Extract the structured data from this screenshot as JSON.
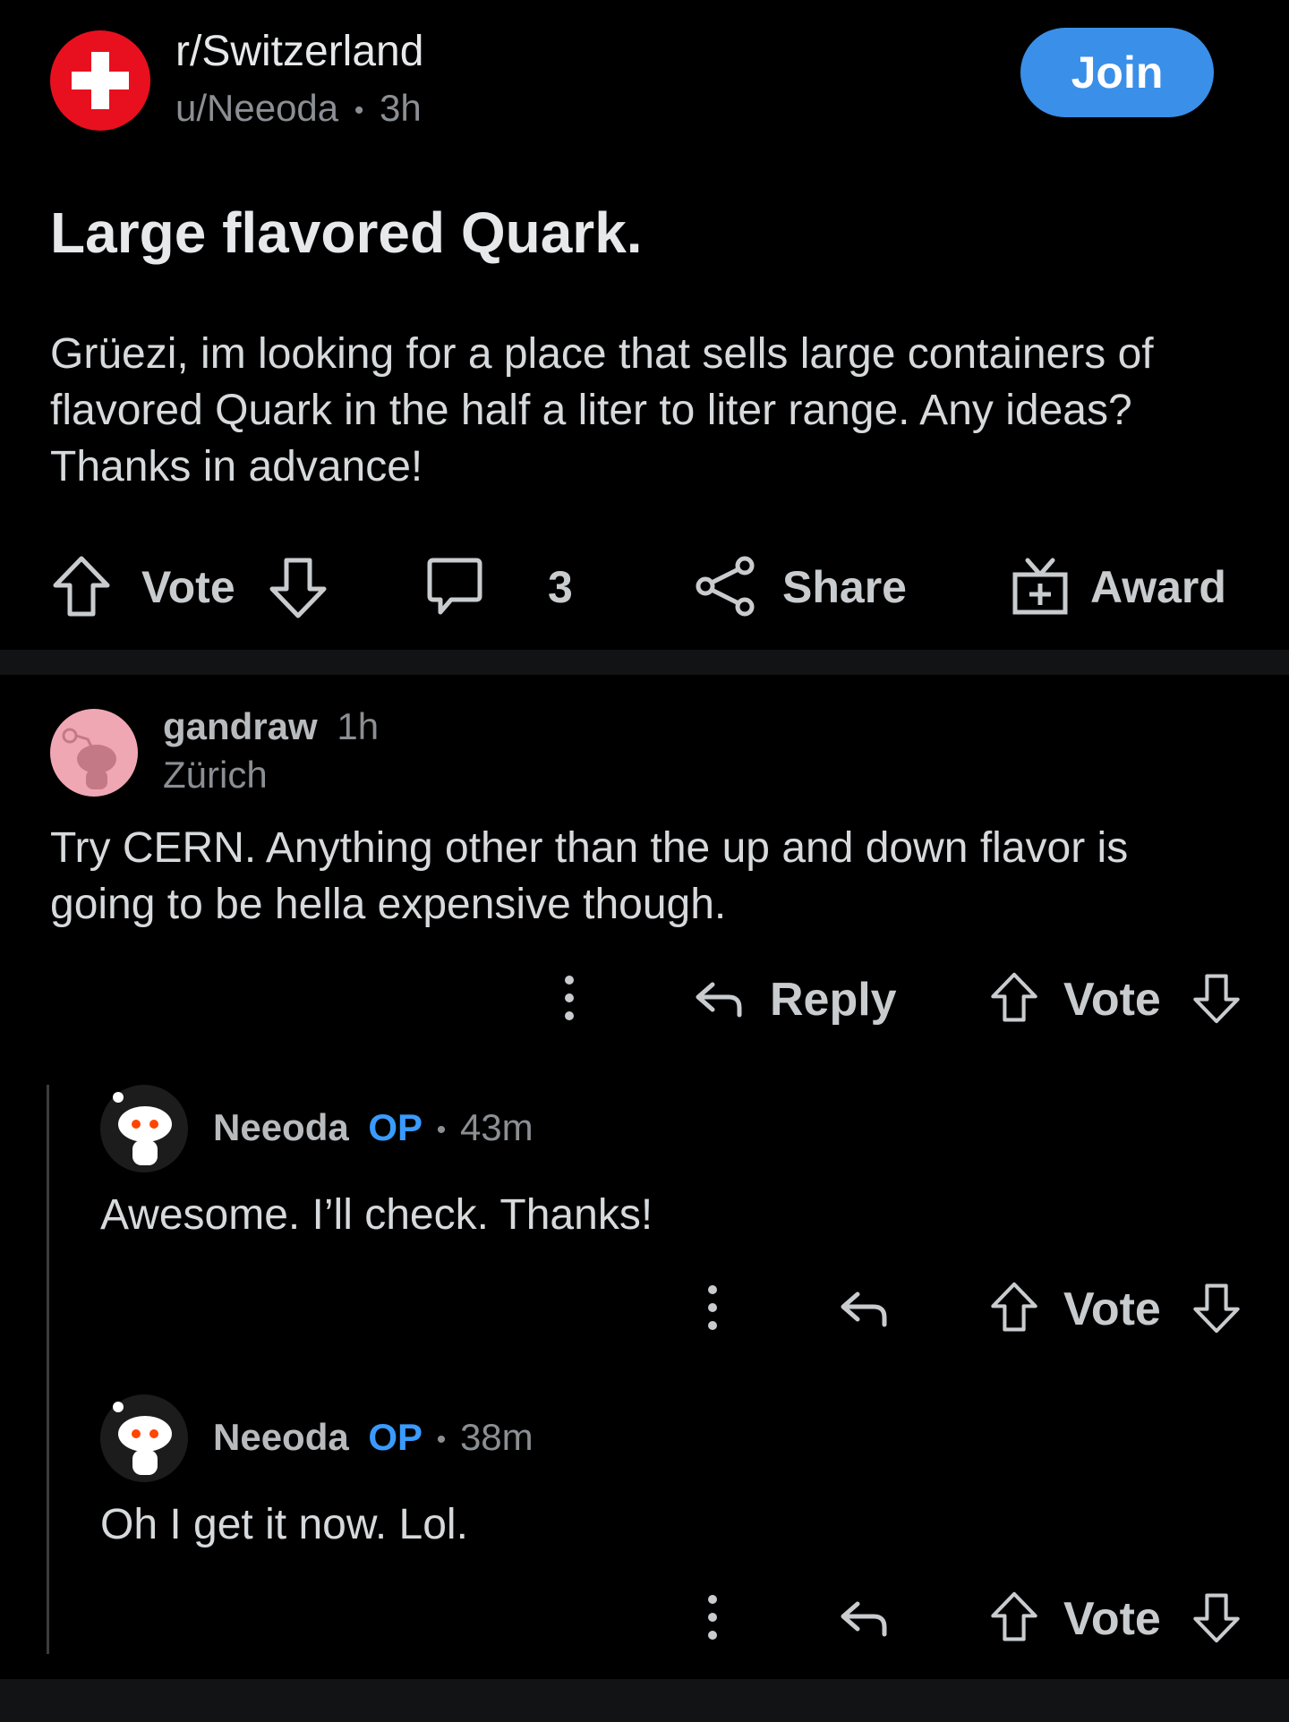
{
  "post": {
    "subreddit": "r/Switzerland",
    "author": "u/Neeoda",
    "separator": "•",
    "age": "3h",
    "join_label": "Join",
    "title": "Large flavored Quark.",
    "body": "Grüezi, im looking for a place that sells large containers of flavored Quark in the half a liter to liter range. Any ideas? Thanks in advance!",
    "vote_label": "Vote",
    "comment_count": "3",
    "share_label": "Share",
    "award_label": "Award"
  },
  "comments": [
    {
      "author": "gandraw",
      "age": "1h",
      "flair": "Zürich",
      "body": "Try CERN. Anything other than the up and down flavor is going to be hella expensive though.",
      "reply_label": "Reply",
      "vote_label": "Vote"
    },
    {
      "author": "Neeoda",
      "op_label": "OP",
      "separator": "•",
      "age": "43m",
      "body": "Awesome. I’ll check. Thanks!",
      "vote_label": "Vote"
    },
    {
      "author": "Neeoda",
      "op_label": "OP",
      "separator": "•",
      "age": "38m",
      "body": "Oh I get it now. Lol.",
      "vote_label": "Vote"
    }
  ],
  "colors": {
    "background": "#000000",
    "text": "#d7dadc",
    "muted": "#8b8f93",
    "join_button": "#3a8fe8",
    "op_badge": "#3a9bff",
    "subreddit_icon": "#e8101f"
  },
  "icons": {
    "subreddit": "swiss-flag-icon",
    "upvote": "arrow-up-icon",
    "downvote": "arrow-down-icon",
    "comment": "speech-bubble-icon",
    "share": "share-nodes-icon",
    "award": "gift-icon",
    "more": "vertical-dots-icon",
    "reply": "reply-arrow-icon"
  }
}
